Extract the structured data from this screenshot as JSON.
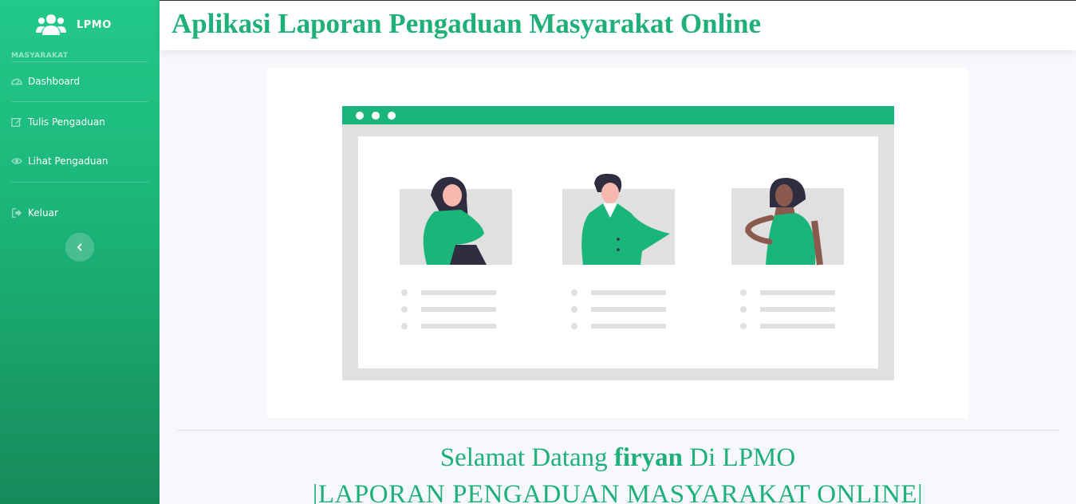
{
  "brand": {
    "name": "LPMO",
    "icon": "users-icon"
  },
  "sidebar": {
    "section_heading": "MASYARAKAT",
    "items": [
      {
        "label": "Dashboard",
        "icon": "dashboard-icon"
      },
      {
        "label": "Tulis Pengaduan",
        "icon": "edit-icon"
      },
      {
        "label": "Lihat Pengaduan",
        "icon": "eye-icon"
      },
      {
        "label": "Keluar",
        "icon": "sign-out-icon"
      }
    ],
    "toggle_icon": "chevron-left-icon"
  },
  "header": {
    "title": "Aplikasi Laporan Pengaduan Masyarakat Online"
  },
  "main": {
    "welcome_prefix": "Selamat Datang ",
    "username": "firyan",
    "welcome_suffix": " Di LPMO",
    "subtitle": "|LAPORAN PENGADUAN MASYARAKAT ONLINE|"
  },
  "colors": {
    "accent": "#1fb07a",
    "sidebar_top": "#22c98a",
    "sidebar_bottom": "#178a5c"
  }
}
